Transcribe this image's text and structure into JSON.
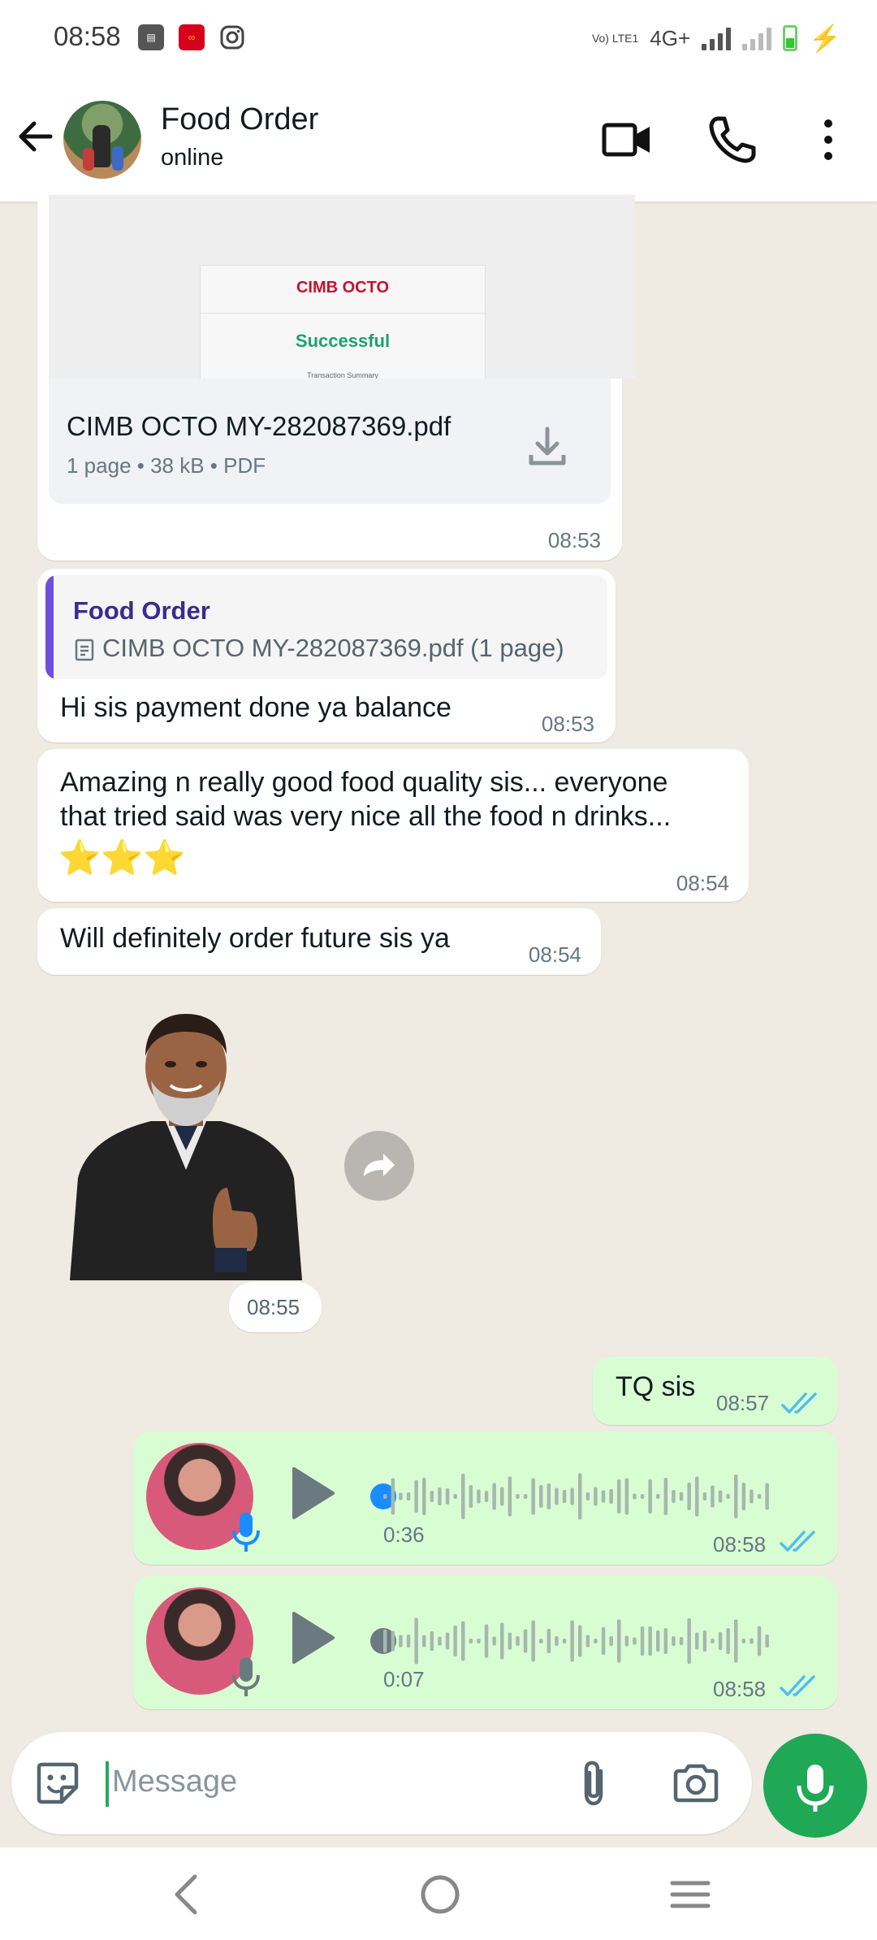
{
  "status_bar": {
    "time": "08:58",
    "network_label": "Vo) LTE1",
    "network_type": "4G+"
  },
  "header": {
    "title": "Food Order",
    "subtitle": "online"
  },
  "messages": {
    "document": {
      "preview_brand": "CIMB OCTO",
      "preview_status": "Successful",
      "preview_sub": "Transaction Summary",
      "filename": "CIMB OCTO MY-282087369.pdf",
      "meta": "1 page • 38 kB • PDF",
      "time": "08:53"
    },
    "reply": {
      "quoted_author": "Food Order",
      "quoted_text": "CIMB OCTO MY-282087369.pdf (1 page)",
      "text": "Hi sis payment done ya balance",
      "time": "08:53"
    },
    "review": {
      "line1": "Amazing n really good food quality sis... everyone",
      "line2": "that tried said was very nice all the food n drinks...",
      "stars": "⭐⭐⭐",
      "time": "08:54"
    },
    "future": {
      "text": "Will definitely order  future sis ya",
      "time": "08:54"
    },
    "sticker": {
      "time": "08:55"
    },
    "tq": {
      "text": "TQ sis",
      "time": "08:57"
    },
    "voice1": {
      "duration": "0:36",
      "time": "08:58",
      "progress": 0.0
    },
    "voice2": {
      "duration": "0:07",
      "time": "08:58",
      "progress": 0.0
    }
  },
  "input": {
    "placeholder": "Message"
  },
  "colors": {
    "accent_green": "#1fa855",
    "outgoing_bubble": "#d9fdd3",
    "read_ticks": "#53bdeb",
    "quote_bar": "#6f4fe0"
  }
}
